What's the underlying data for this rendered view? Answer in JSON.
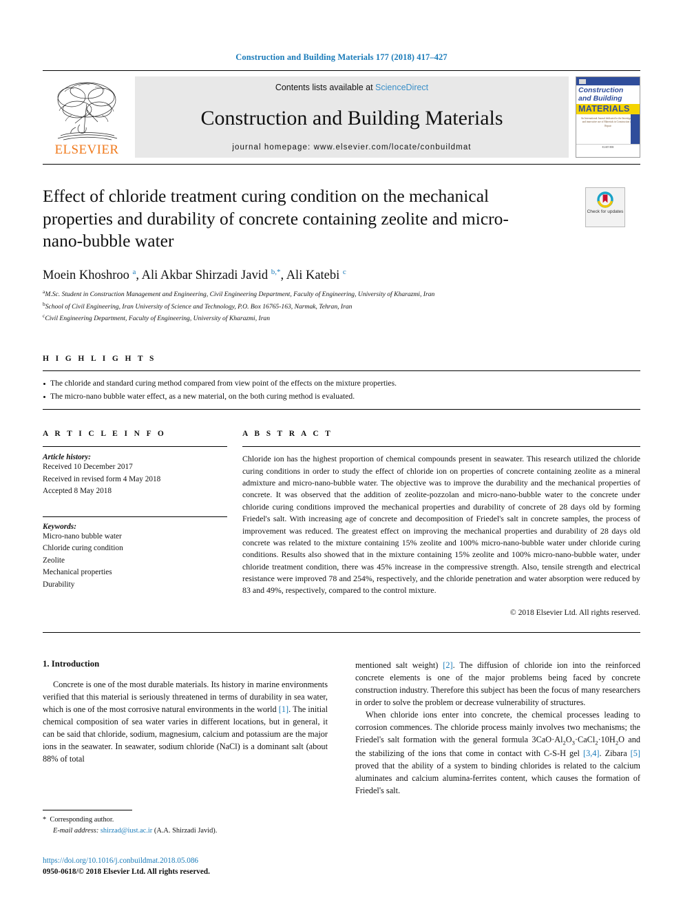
{
  "running_head": "Construction and Building Materials 177 (2018) 417–427",
  "masthead": {
    "publisher_logo_text": "ELSEVIER",
    "contents_prefix": "Contents lists available at ",
    "contents_link": "ScienceDirect",
    "journal_name": "Construction and Building Materials",
    "homepage_line": "journal homepage: www.elsevier.com/locate/conbuildmat",
    "cover": {
      "line1": "Construction",
      "line2": "and Building",
      "line3": "MATERIALS",
      "fine_print": "An International Journal dedicated to the Investigation and innovative use of Materials in Construction and Repair",
      "foot_print": "ELSEVIER"
    }
  },
  "article": {
    "title": "Effect of chloride treatment curing condition on the mechanical properties and durability of concrete containing zeolite and micro-nano-bubble water",
    "crossmark_label": "Check for updates",
    "authors_html": "Moein Khoshroo <sup>a</sup>, Ali Akbar Shirzadi Javid <sup>b,*</sup>, Ali Katebi <sup>c</sup>",
    "affiliations": [
      {
        "mark": "a",
        "text": "M.Sc. Student in Construction Management and Engineering, Civil Engineering Department, Faculty of Engineering, University of Kharazmi, Iran"
      },
      {
        "mark": "b",
        "text": "School of Civil Engineering, Iran University of Science and Technology, P.O. Box 16765-163, Narmak, Tehran, Iran"
      },
      {
        "mark": "c",
        "text": "Civil Engineering Department, Faculty of Engineering, University of Kharazmi, Iran"
      }
    ]
  },
  "highlights": {
    "label": "H I G H L I G H T S",
    "items": [
      "The chloride and standard curing method compared from view point of the effects on the mixture properties.",
      "The micro-nano bubble water effect, as a new material, on the both curing method is evaluated."
    ]
  },
  "article_info": {
    "label": "A R T I C L E   I N F O",
    "history_label": "Article history:",
    "history": [
      "Received 10 December 2017",
      "Received in revised form 4 May 2018",
      "Accepted 8 May 2018"
    ],
    "keywords_label": "Keywords:",
    "keywords": [
      "Micro-nano bubble water",
      "Chloride curing condition",
      "Zeolite",
      "Mechanical properties",
      "Durability"
    ]
  },
  "abstract": {
    "label": "A B S T R A C T",
    "text": "Chloride ion has the highest proportion of chemical compounds present in seawater. This research utilized the chloride curing conditions in order to study the effect of chloride ion on properties of concrete containing zeolite as a mineral admixture and micro-nano-bubble water. The objective was to improve the durability and the mechanical properties of concrete. It was observed that the addition of zeolite-pozzolan and micro-nano-bubble water to the concrete under chloride curing conditions improved the mechanical properties and durability of concrete of 28 days old by forming Friedel's salt. With increasing age of concrete and decomposition of Friedel's salt in concrete samples, the process of improvement was reduced. The greatest effect on improving the mechanical properties and durability of 28 days old concrete was related to the mixture containing 15% zeolite and 100% micro-nano-bubble water under chloride curing conditions. Results also showed that in the mixture containing 15% zeolite and 100% micro-nano-bubble water, under chloride treatment condition, there was 45% increase in the compressive strength. Also, tensile strength and electrical resistance were improved 78 and 254%, respectively, and the chloride penetration and water absorption were reduced by 83 and 49%, respectively, compared to the control mixture.",
    "copyright": "© 2018 Elsevier Ltd. All rights reserved."
  },
  "introduction": {
    "heading": "1. Introduction",
    "left_para1_html": "Concrete is one of the most durable materials. Its history in marine environments verified that this material is seriously threatened in terms of durability in sea water, which is one of the most corrosive natural environments in the world <span class=\"ref\">[1]</span>. The initial chemical composition of sea water varies in different locations, but in general, it can be said that chloride, sodium, magnesium, calcium and potassium are the major ions in the seawater. In seawater, sodium chloride (NaCl) is a dominant salt (about 88% of total",
    "right_para1_html": "mentioned salt weight) <span class=\"ref\">[2]</span>. The diffusion of chloride ion into the reinforced concrete elements is one of the major problems being faced by concrete construction industry. Therefore this subject has been the focus of many researchers in order to solve the problem or decrease vulnerability of structures.",
    "right_para2_html": "When chloride ions enter into concrete, the chemical processes leading to corrosion commences. The chloride process mainly involves two mechanisms; the Friedel's salt formation with the general formula 3CaO&middot;Al<sub>2</sub>O<sub>3</sub>&middot;CaCl<sub>2</sub>&middot;10H<sub>2</sub>O and the stabilizing of the ions that come in contact with C-S-H gel <span class=\"ref\">[3,4]</span>. Zibara <span class=\"ref\">[5]</span> proved that the ability of a system to binding chlorides is related to the calcium aluminates and calcium alumina-ferrites content, which causes the formation of Friedel's salt."
  },
  "footnote": {
    "corresponding": "Corresponding author.",
    "email_label": "E-mail address:",
    "email": "shirzad@iust.ac.ir",
    "email_owner": "(A.A. Shirzadi Javid)."
  },
  "bottom": {
    "doi": "https://doi.org/10.1016/j.conbuildmat.2018.05.086",
    "issn": "0950-0618/© 2018 Elsevier Ltd. All rights reserved."
  },
  "colors": {
    "link_blue": "#1a7bb9",
    "elsevier_orange": "#f07a1d",
    "cover_blue": "#2f4d9b",
    "cover_yellow": "#f5d400",
    "band_grey": "#e8e8e8"
  }
}
